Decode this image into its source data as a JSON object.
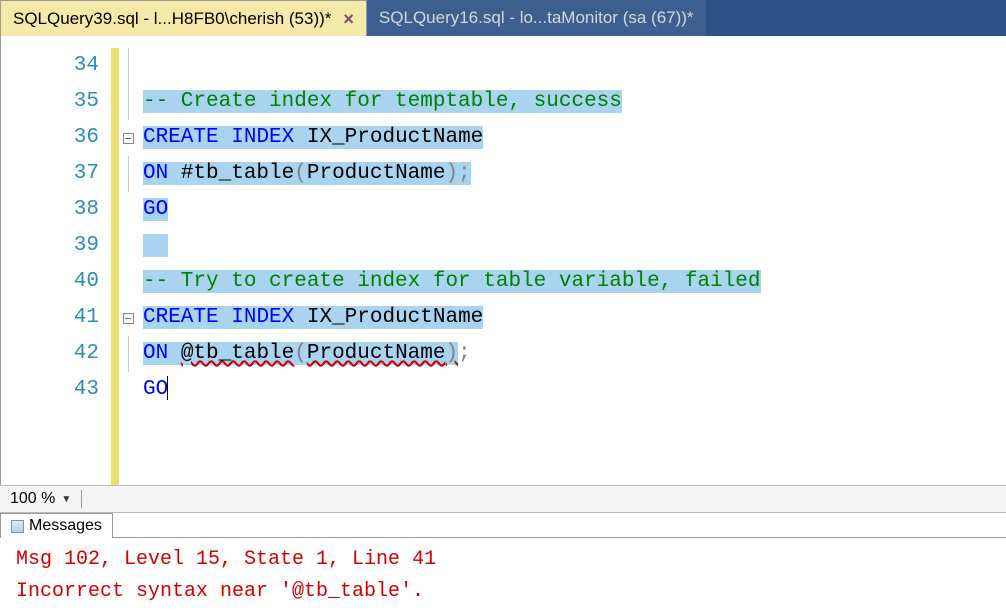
{
  "tabs": [
    {
      "label": "SQLQuery39.sql - l...H8FB0\\cherish (53))*",
      "active": true
    },
    {
      "label": "SQLQuery16.sql - lo...taMonitor (sa (67))*",
      "active": false
    }
  ],
  "editor": {
    "lines": [
      {
        "n": "34",
        "tokens": [],
        "outline": "line"
      },
      {
        "n": "35",
        "tokens": [
          {
            "t": "-- Create index for temptable, success",
            "c": "tk-comment",
            "sel": true
          }
        ],
        "outline": "line"
      },
      {
        "n": "36",
        "tokens": [
          {
            "t": "CREATE",
            "c": "tk-keyword",
            "sel": true
          },
          {
            "t": " ",
            "c": "",
            "sel": true
          },
          {
            "t": "INDEX",
            "c": "tk-keyword",
            "sel": true
          },
          {
            "t": " IX_ProductName",
            "c": "tk-ident",
            "sel": true
          }
        ],
        "outline": "box"
      },
      {
        "n": "37",
        "tokens": [
          {
            "t": "ON",
            "c": "tk-keyword",
            "sel": true
          },
          {
            "t": " #tb_table",
            "c": "tk-ident",
            "sel": true
          },
          {
            "t": "(",
            "c": "tk-punct",
            "sel": true
          },
          {
            "t": "ProductName",
            "c": "tk-ident",
            "sel": true
          },
          {
            "t": ");",
            "c": "tk-punct",
            "sel": true
          }
        ],
        "outline": "line"
      },
      {
        "n": "38",
        "tokens": [
          {
            "t": "GO",
            "c": "tk-keyword",
            "sel": true
          }
        ],
        "outline": "none"
      },
      {
        "n": "39",
        "tokens": [
          {
            "t": "  ",
            "c": "",
            "sel": true
          }
        ],
        "outline": "none"
      },
      {
        "n": "40",
        "tokens": [
          {
            "t": "-- Try to create index for table variable, failed",
            "c": "tk-comment",
            "sel": true
          }
        ],
        "outline": "none"
      },
      {
        "n": "41",
        "tokens": [
          {
            "t": "CREATE",
            "c": "tk-keyword",
            "sel": true
          },
          {
            "t": " ",
            "c": "",
            "sel": true
          },
          {
            "t": "INDEX",
            "c": "tk-keyword",
            "sel": true
          },
          {
            "t": " IX_ProductName",
            "c": "tk-ident",
            "sel": true
          }
        ],
        "outline": "box"
      },
      {
        "n": "42",
        "tokens": [
          {
            "t": "ON",
            "c": "tk-keyword",
            "sel": true
          },
          {
            "t": " ",
            "c": "",
            "sel": true
          },
          {
            "t": "@tb_table",
            "c": "tk-ident err-underline",
            "sel": true
          },
          {
            "t": "(",
            "c": "tk-punct",
            "sel": true
          },
          {
            "t": "ProductName",
            "c": "tk-ident err-underline",
            "sel": true
          },
          {
            "t": ")",
            "c": "tk-punct err-underline",
            "sel": true
          },
          {
            "t": ";",
            "c": "tk-punct",
            "sel": false
          }
        ],
        "outline": "line"
      },
      {
        "n": "43",
        "tokens": [
          {
            "t": "GO",
            "c": "tk-keyword",
            "sel": false,
            "caret": true
          }
        ],
        "outline": "none"
      }
    ]
  },
  "zoom": {
    "value": "100 %"
  },
  "messagesTab": {
    "label": "Messages"
  },
  "messages": {
    "line1": "Msg 102, Level 15, State 1, Line 41",
    "line2": "Incorrect syntax near '@tb_table'."
  }
}
